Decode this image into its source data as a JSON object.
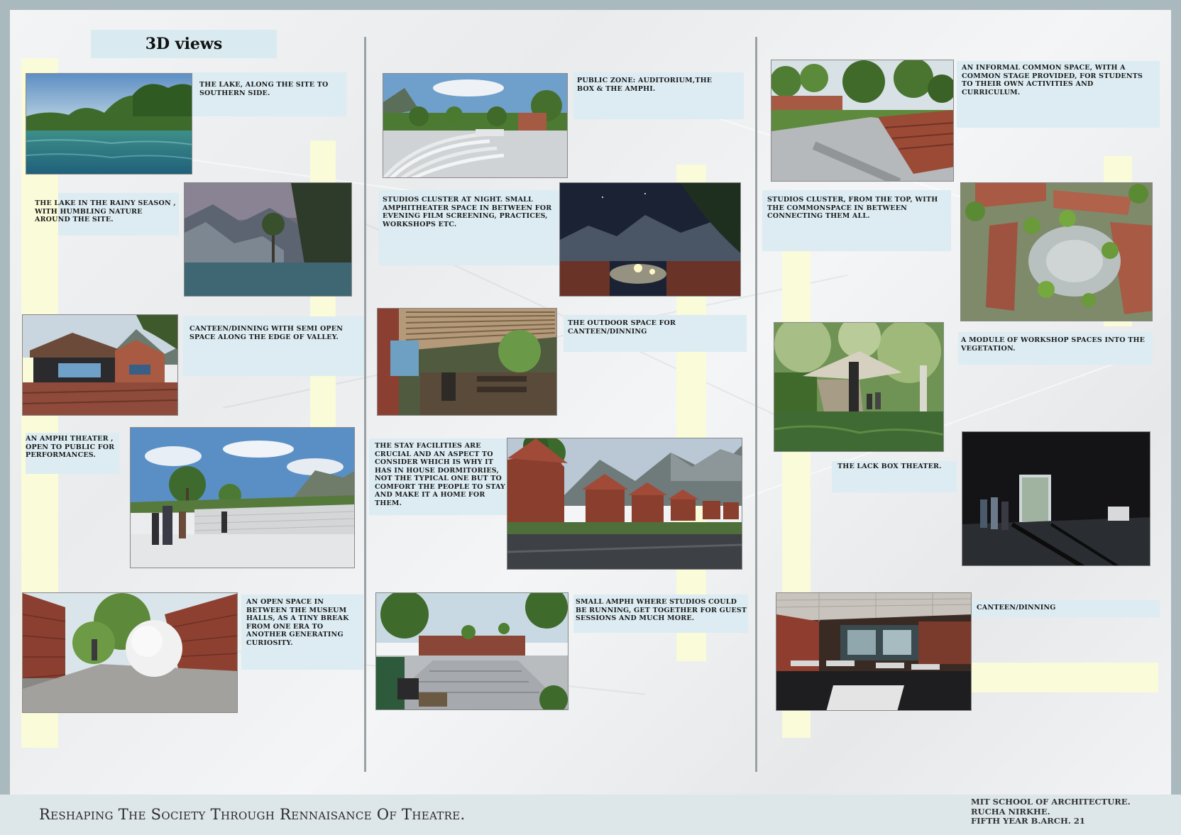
{
  "heading": "3D views",
  "captions": {
    "lake": "THE LAKE, ALONG THE SITE TO SOUTHERN SIDE.",
    "lake_rain": "THE LAKE IN THE RAINY SEASON , WITH HUMBLING NATURE AROUND THE SITE.",
    "canteen_valley": "CANTEEN/DINNING WITH SEMI OPEN SPACE ALONG THE EDGE OF VALLEY.",
    "amphi_public": "AN AMPHI THEATER , OPEN TO PUBLIC FOR PERFORMANCES.",
    "museum": "AN OPEN SPACE IN BETWEEN THE MUSEUM HALLS, AS A TINY BREAK FROM ONE ERA TO ANOTHER GENERATING CURIOSITY.",
    "public_zone": "PUBLIC ZONE: AUDITORIUM,THE BOX & THE AMPHI.",
    "studios_night": "STUDIOS CLUSTER AT NIGHT. SMALL AMPHITHEATER SPACE IN BETWEEN FOR EVENING FILM SCREENING, PRACTICES, WORKSHOPS ETC.",
    "outdoor_canteen": "THE OUTDOOR SPACE FOR CANTEEN/DINNING",
    "stay": "THE STAY FACILITIES ARE CRUCIAL AND AN ASPECT TO CONSIDER WHICH IS WHY IT HAS IN HOUSE DORMITORIES, NOT THE TYPICAL ONE BUT TO COMFORT THE PEOPLE TO STAY AND MAKE IT A HOME FOR THEM.",
    "small_amphi": "SMALL AMPHI WHERE STUDIOS COULD BE RUNNING, GET TOGETHER FOR GUEST SESSIONS AND MUCH MORE.",
    "common_space": "AN INFORMAL COMMON SPACE, WITH A COMMON STAGE PROVIDED, FOR STUDENTS TO THEIR OWN ACTIVITIES AND CURRICULUM.",
    "studios_top": "STUDIOS CLUSTER, FROM THE TOP, WITH THE COMMONSPACE IN BETWEEN CONNECTING THEM ALL.",
    "workshop": "A MODULE OF WORKSHOP SPACES INTO THE VEGETATION.",
    "black_box": "THE LACK BOX THEATER.",
    "canteen": "CANTEEN/DINNING"
  },
  "footer": {
    "title": "Reshaping The Society Through Rennaisance Of Theatre.",
    "credits": [
      "MIT SCHOOL OF ARCHITECTURE.",
      "RUCHA NIRKHE.",
      "FIFTH YEAR B.ARCH. 21"
    ]
  },
  "colors": {
    "sky": "#9fc3df",
    "brick": "#a0513c",
    "foliage": "#4f7a36",
    "water": "#2f7f86",
    "yellow_strip": "#fafbd9",
    "blue_strip": "#dcecf2"
  }
}
